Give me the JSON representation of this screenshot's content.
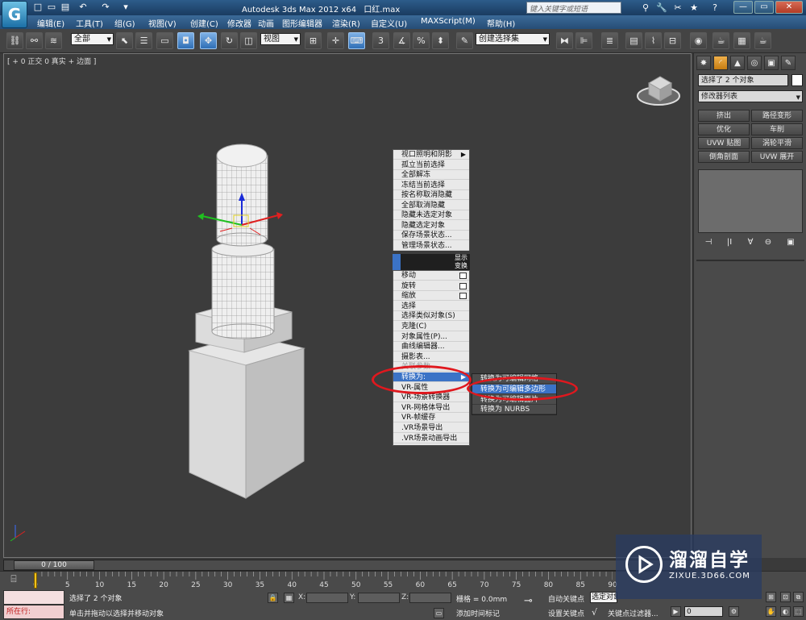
{
  "window": {
    "logo_glyph": "G",
    "title_app": "Autodesk 3ds Max  2012 x64",
    "title_file": "口红.max",
    "search_placeholder": "键入关键字或短语"
  },
  "quick_access": [
    "□",
    "▭",
    "▤",
    "↶",
    "↷",
    "▾"
  ],
  "title_icons": [
    "⚲",
    "🔧",
    "✂",
    "★",
    "?"
  ],
  "window_buttons": {
    "minimize": "—",
    "maximize": "▭",
    "close": "✕"
  },
  "menu": [
    "编辑(E)",
    "工具(T)",
    "组(G)",
    "视图(V)",
    "创建(C)",
    "修改器",
    "动画",
    "图形编辑器",
    "渲染(R)",
    "自定义(U)",
    "MAXScript(M)",
    "帮助(H)"
  ],
  "toolbar": {
    "selection_filter": "全部",
    "ref_coord": "视图",
    "named_selection": "创建选择集"
  },
  "viewport": {
    "label": "[ + 0 正交 0 真实 + 边面 ]"
  },
  "quad_menu": {
    "upper_section": "显示",
    "lower_section": "变换",
    "top_items": [
      "视口照明和阴影",
      "孤立当前选择",
      "全部解冻",
      "冻结当前选择",
      "按名称取消隐藏",
      "全部取消隐藏",
      "隐藏未选定对象",
      "隐藏选定对象",
      "保存场景状态...",
      "管理场景状态..."
    ],
    "bottom_items": [
      "移动",
      "旋转",
      "缩放",
      "选择",
      "选择类似对象(S)",
      "克隆(C)",
      "对象属性(P)...",
      "曲线编辑器...",
      "摄影表...",
      "关联参数",
      "转换为:",
      "VR-属性",
      "VR-场景转换器",
      "VR-网格体导出",
      "VR-帧缓存",
      ".VR场景导出",
      ".VR场景动画导出"
    ],
    "submenu": [
      "转换为可编辑网格",
      "转换为可编辑多边形",
      "转换为可编辑面片",
      "转换为 NURBS"
    ]
  },
  "command_panel": {
    "tabs": [
      "✸",
      "◜",
      "▲",
      "◎",
      "▣",
      "✎"
    ],
    "selection_text": "选择了 2 个对象",
    "modifier_list": "修改器列表",
    "buttons": [
      "挤出",
      "路径变形",
      "优化",
      "车削",
      "UVW 贴图",
      "涡轮平滑",
      "倒角剖面",
      "UVW 展开"
    ],
    "stack_tools": [
      "⊣",
      "|I",
      "∀",
      "⊖",
      "▣"
    ]
  },
  "timeline": {
    "slider_text": "0 / 100",
    "tick_labels": [
      "0",
      "5",
      "10",
      "15",
      "20",
      "25",
      "30",
      "35",
      "40",
      "45",
      "50",
      "55",
      "60",
      "65",
      "70",
      "75",
      "80",
      "85",
      "90"
    ]
  },
  "status": {
    "script_label": "所在行:",
    "selection": "选择了 2 个对象",
    "prompt": "单击并拖动以选择并移动对象",
    "x_label": "X:",
    "y_label": "Y:",
    "z_label": "Z:",
    "grid": "栅格 = 0.0mm",
    "time_tag": "添加时间标记",
    "auto_key": "自动关键点",
    "set_key": "设置关键点",
    "sel_dropdown": "选定对象",
    "key_filters": "关键点过滤器...",
    "frame": "0"
  },
  "watermark": {
    "name": "溜溜自学",
    "url": "ZIXUE.3D66.COM"
  },
  "colors": {
    "highlight": "#3b73c6",
    "annotation": "#e0181e",
    "active_tab": "#f0b04a"
  }
}
